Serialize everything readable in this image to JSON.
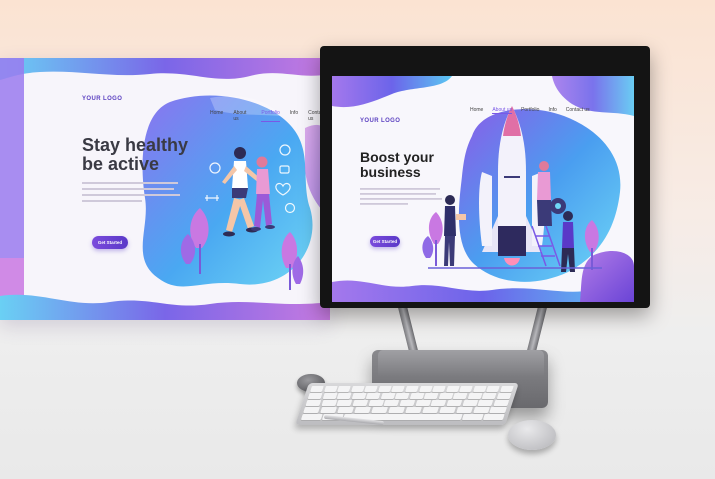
{
  "left_page": {
    "logo": "YOUR LOGO",
    "nav": [
      "Home",
      "About us",
      "Portfolio",
      "Info",
      "Contact us"
    ],
    "active_nav_index": 2,
    "headline_line1": "Stay healthy",
    "headline_line2": "be active",
    "cta_label": "Get Started"
  },
  "monitor_page": {
    "logo": "YOUR LOGO",
    "nav": [
      "Home",
      "About us",
      "Portfolio",
      "Info",
      "Contact us"
    ],
    "active_nav_index": 1,
    "headline_line1": "Boost your",
    "headline_line2": "business",
    "cta_label": "Get Started"
  },
  "colors": {
    "purple": "#7a58e6",
    "deep_purple": "#5a39c8",
    "blue": "#3fa0f0",
    "cyan": "#6fd3f5",
    "pink": "#d27ce0",
    "text_dark": "#3a3a44"
  },
  "icons": {
    "fitness_icons": [
      "trophy-icon",
      "heart-icon",
      "dumbbell-icon",
      "stopwatch-icon",
      "watch-icon",
      "person-icon"
    ],
    "gear": "gear-icon"
  }
}
